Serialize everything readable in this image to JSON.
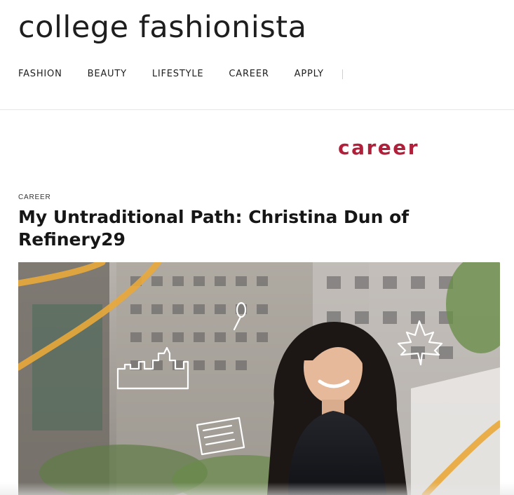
{
  "site": {
    "logo_text": "college fashionista"
  },
  "nav": {
    "items": [
      {
        "label": "FASHION"
      },
      {
        "label": "BEAUTY"
      },
      {
        "label": "LIFESTYLE"
      },
      {
        "label": "CAREER"
      },
      {
        "label": "APPLY"
      }
    ]
  },
  "section": {
    "banner": "career"
  },
  "article": {
    "category": "CAREER",
    "title": "My Untraditional Path: Christina Dun of Refinery29"
  },
  "hero": {
    "icons": [
      "skyline-icon",
      "spoon-icon",
      "maple-leaf-icon",
      "newspaper-icon"
    ]
  },
  "colors": {
    "accent": "#b1203a",
    "doodle_yellow": "#e9a93a"
  }
}
